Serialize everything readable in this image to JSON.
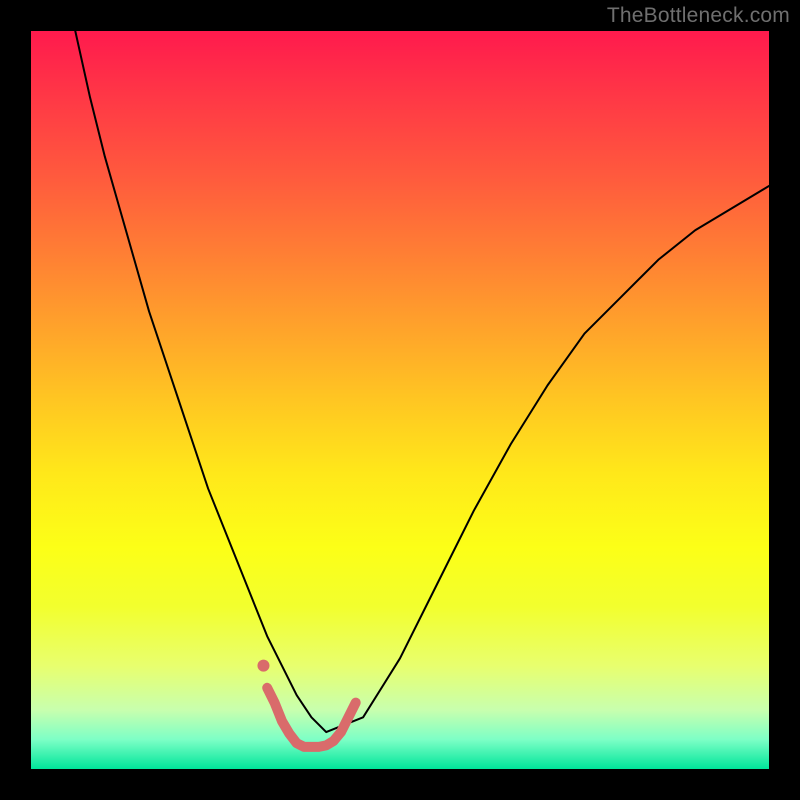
{
  "watermark": "TheBottleneck.com",
  "chart_data": {
    "type": "line",
    "title": "",
    "xlabel": "",
    "ylabel": "",
    "xlim": [
      0,
      100
    ],
    "ylim": [
      0,
      100
    ],
    "grid": false,
    "legend": false,
    "series": [
      {
        "name": "bottleneck-curve",
        "stroke": "#000000",
        "stroke_width": 2,
        "x": [
          6,
          8,
          10,
          12,
          14,
          16,
          18,
          20,
          22,
          24,
          26,
          28,
          30,
          32,
          34,
          36,
          38,
          40,
          45,
          50,
          55,
          60,
          65,
          70,
          75,
          80,
          85,
          90,
          95,
          100
        ],
        "y": [
          100,
          91,
          83,
          76,
          69,
          62,
          56,
          50,
          44,
          38,
          33,
          28,
          23,
          18,
          14,
          10,
          7,
          5,
          7,
          15,
          25,
          35,
          44,
          52,
          59,
          64,
          69,
          73,
          76,
          79
        ]
      },
      {
        "name": "highlight-trough",
        "stroke": "#d96b6b",
        "stroke_width": 10,
        "x": [
          32,
          33,
          34,
          35,
          36,
          37,
          38,
          39,
          40,
          41,
          42,
          43,
          44
        ],
        "y": [
          11,
          9,
          6.5,
          4.8,
          3.5,
          3,
          3,
          3,
          3.2,
          3.8,
          5,
          7,
          9
        ]
      },
      {
        "name": "highlight-dot",
        "type": "scatter",
        "stroke": "#d96b6b",
        "x": [
          31.5
        ],
        "y": [
          14
        ]
      }
    ]
  },
  "palette": {
    "gradient_top": "#ff1a4d",
    "gradient_mid": "#ffe81a",
    "gradient_bottom": "#00e59a",
    "curve": "#000000",
    "highlight": "#d96b6b",
    "frame": "#000000",
    "watermark_text": "#6f6f6f"
  }
}
